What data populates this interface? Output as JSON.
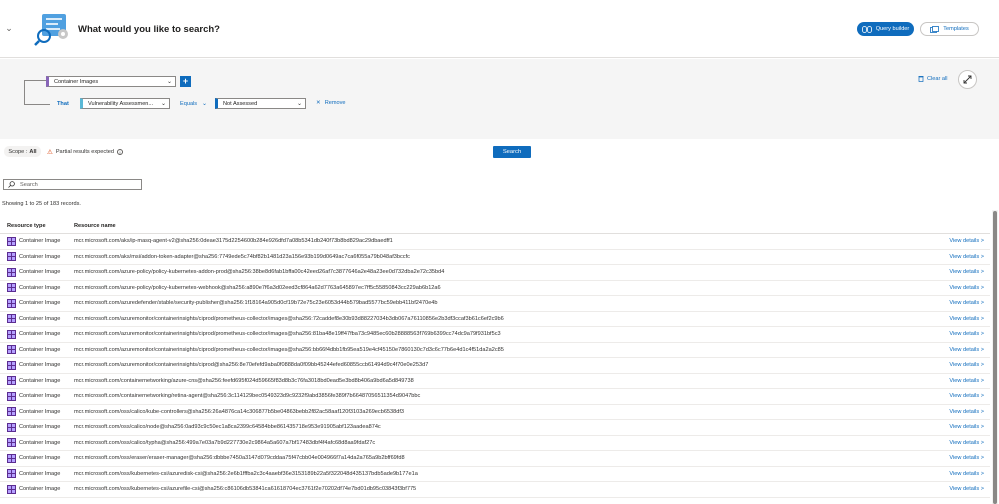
{
  "header": {
    "title": "What would you like to search?",
    "query_builder_label": "Query builder",
    "templates_label": "Templates"
  },
  "filter": {
    "entity_value": "Container Images",
    "that_label": "That",
    "property_value": "Vulnerability Assessmen...",
    "operator_value": "Equals",
    "condition_value": "Not Assessed",
    "remove_label": "Remove",
    "clear_all_label": "Clear all"
  },
  "scope": {
    "label": "Scope :",
    "value": "All",
    "partial_label": "Partial results expected",
    "search_button": "Search"
  },
  "results": {
    "search_placeholder": "Search",
    "records_text": "Showing 1 to 25 of 183 records.",
    "columns": {
      "type": "Resource type",
      "name": "Resource name"
    },
    "action_label": "View details >",
    "rows": [
      {
        "type": "Container Image",
        "name": "mcr.microsoft.com/aks/ip-masq-agent-v2@sha256:0deae3175d2254600b284e926dfd7a08b5341db240f73b8bd829ac29dbaedff1"
      },
      {
        "type": "Container Image",
        "name": "mcr.microsoft.com/aks/msi/addon-token-adapter@sha256:7749ede5c74bf82b1481d23a156e93b199d0649ac7ca6f055a79b048af3bccfc"
      },
      {
        "type": "Container Image",
        "name": "mcr.microsoft.com/azure-policy/policy-kubernetes-addon-prod@sha256:38be8d6fab1bffa00c42eed26af7c3877646a2e48a23ee0d732dba2e72c35bd4"
      },
      {
        "type": "Container Image",
        "name": "mcr.microsoft.com/azure-policy/policy-kubernetes-webhook@sha256:a890e7f6a3d02eed3cf864a62d7763a645897ec7ff5c55850843cc229ab6b12a6"
      },
      {
        "type": "Container Image",
        "name": "mcr.microsoft.com/azuredefender/stable/security-publisher@sha256:1f18164a905d0cf19b72e75c23e6053d44b579bad5577bc59ebb411bf2470e4b"
      },
      {
        "type": "Container Image",
        "name": "mcr.microsoft.com/azuremonitor/containerinsights/ciprod/prometheus-collector/images@sha256:72caddef8e30b93d88227034b3db067a76110856e2b3df3ccaf3b61c6ef2c9b6"
      },
      {
        "type": "Container Image",
        "name": "mcr.microsoft.com/azuremonitor/containerinsights/ciprod/prometheus-collector/images@sha256:81ba48e19ff47fba73c9485ec60b28888563f769b6399cc74dc9a79f931bf5c3"
      },
      {
        "type": "Container Image",
        "name": "mcr.microsoft.com/azuremonitor/containerinsights/ciprod/prometheus-collector/images@sha256:bb66f4dbb1fb95ea519e4cf45150e7860130c7d3c6c77b6e4d1c4f51da2a2c85"
      },
      {
        "type": "Container Image",
        "name": "mcr.microsoft.com/azuremonitor/containerinsights/ciprod@sha256:8e70efefd9aba0f0888da0f09bb45244efed60855ccb61494d9c4f70e0e253d7"
      },
      {
        "type": "Container Image",
        "name": "mcr.microsoft.com/containernetworking/azure-cns@sha256:feefd695f024d59665f83d8b3c76fa3018bd0ead5e3bd8b406a9bd6a5d849738"
      },
      {
        "type": "Container Image",
        "name": "mcr.microsoft.com/containernetworking/retina-agent@sha256:3c114129bec0549323d9c9232f9abd3856fe389f7b66487056511354d9047bbc"
      },
      {
        "type": "Container Image",
        "name": "mcr.microsoft.com/oss/calico/kube-controllers@sha256:26a4876ca14c306877b5be04863bebb2f82ac58aaf120f3103a269ecb6538df3"
      },
      {
        "type": "Container Image",
        "name": "mcr.microsoft.com/oss/calico/node@sha256:0ad93c9c50ec1a8ca2399c64584bbe861435718e953e91905abf123aadea874c"
      },
      {
        "type": "Container Image",
        "name": "mcr.microsoft.com/oss/calico/typha@sha256:499a7e03a7b9d227730e2c9864a5a607a7bf17483dbf4f4afc68d8aa9fdaf27c"
      },
      {
        "type": "Container Image",
        "name": "mcr.microsoft.com/oss/eraser/eraser-manager@sha256:dbbbe7450a3147d079cddaa75f47cbb04e004966f7a14da2a765a9b2bff69fd8"
      },
      {
        "type": "Container Image",
        "name": "mcr.microsoft.com/oss/kubernetes-csi/azuredisk-csi@sha256:2e6b1fffba2c3c4aaebf36e3153189b22a5f322048d435137bdb5ade9b177e1a"
      },
      {
        "type": "Container Image",
        "name": "mcr.microsoft.com/oss/kubernetes-csi/azurefile-csi@sha256:c86106db53841ca61618704ec3761f2e70202df74e7bd01db95c03843f3bf775"
      }
    ]
  }
}
